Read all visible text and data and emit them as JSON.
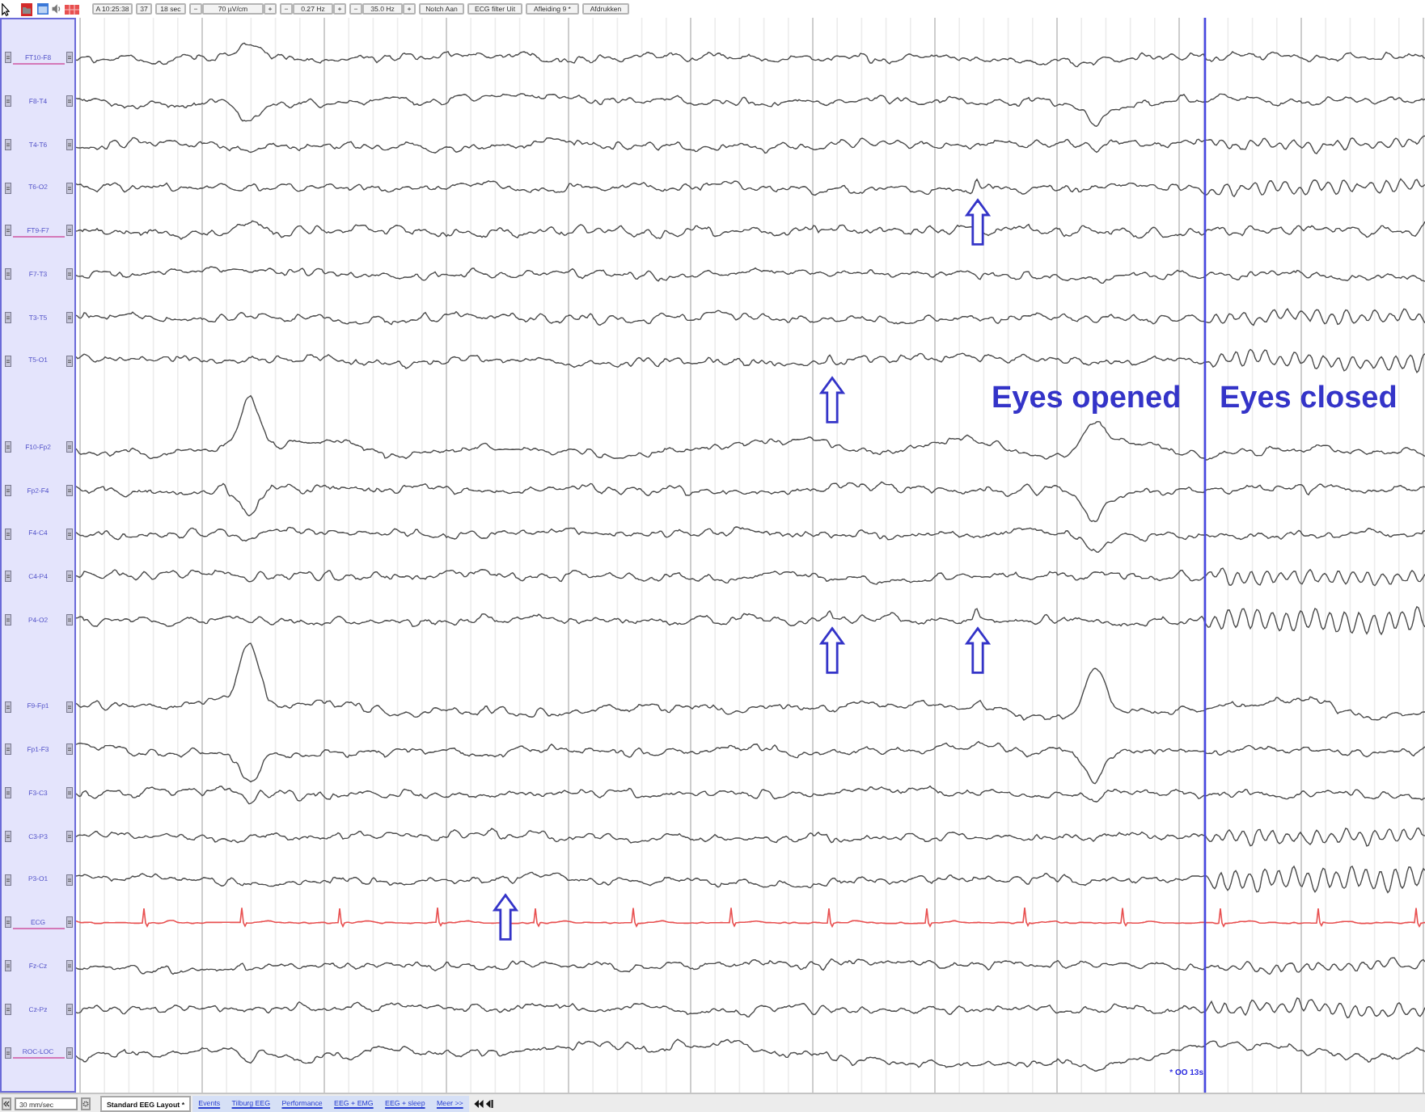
{
  "toolbar": {
    "clock": "A 10:25:38",
    "counter": "37",
    "timebase": "18 sec",
    "steppers": [
      {
        "decrease": "−",
        "value": "70 µV/cm",
        "increase": "+"
      },
      {
        "decrease": "−",
        "value": "0.27 Hz",
        "increase": "+"
      },
      {
        "decrease": "−",
        "value": "35.0 Hz",
        "increase": "+"
      }
    ],
    "buttons": [
      "Notch Aan",
      "ECG filter Uit",
      "Afleiding 9 *",
      "Afdrukken"
    ]
  },
  "channel_groups": [
    {
      "channels": [
        {
          "label": "FT10-F8",
          "kind": "eeg",
          "highlighted": true
        },
        {
          "label": "F8-T4",
          "kind": "eeg",
          "highlighted": false
        },
        {
          "label": "T4-T6",
          "kind": "eeg",
          "highlighted": false
        },
        {
          "label": "T6-O2",
          "kind": "eeg",
          "highlighted": false
        },
        {
          "label": "FT9-F7",
          "kind": "eeg",
          "highlighted": true
        },
        {
          "label": "F7-T3",
          "kind": "eeg",
          "highlighted": false
        },
        {
          "label": "T3-T5",
          "kind": "eeg",
          "highlighted": false
        },
        {
          "label": "T5-O1",
          "kind": "eeg",
          "highlighted": false
        }
      ]
    },
    {
      "channels": [
        {
          "label": "F10-Fp2",
          "kind": "eeg",
          "highlighted": false
        },
        {
          "label": "Fp2-F4",
          "kind": "eeg",
          "highlighted": false
        },
        {
          "label": "F4-C4",
          "kind": "eeg",
          "highlighted": false
        },
        {
          "label": "C4-P4",
          "kind": "eeg",
          "highlighted": false
        },
        {
          "label": "P4-O2",
          "kind": "eeg",
          "highlighted": false
        }
      ]
    },
    {
      "channels": [
        {
          "label": "F9-Fp1",
          "kind": "eeg",
          "highlighted": false
        },
        {
          "label": "Fp1-F3",
          "kind": "eeg",
          "highlighted": false
        },
        {
          "label": "F3-C3",
          "kind": "eeg",
          "highlighted": false
        },
        {
          "label": "C3-P3",
          "kind": "eeg",
          "highlighted": false
        },
        {
          "label": "P3-O1",
          "kind": "eeg",
          "highlighted": false
        },
        {
          "label": "ECG",
          "kind": "ecg",
          "highlighted": true
        },
        {
          "label": "Fz-Cz",
          "kind": "eeg",
          "highlighted": false
        },
        {
          "label": "Cz-Pz",
          "kind": "eeg",
          "highlighted": false
        },
        {
          "label": "ROC-LOC",
          "kind": "eeg",
          "highlighted": true
        }
      ]
    }
  ],
  "annotations": [
    {
      "text": "Eyes opened"
    },
    {
      "text": "Eyes closed"
    }
  ],
  "event_marker": {
    "label": "* OO 13s"
  },
  "bottom_bar": {
    "speed": "30 mm/sec",
    "layout_tabs": [
      {
        "label": "Standard EEG Layout *",
        "selected": true
      },
      {
        "label": "Events",
        "selected": false
      },
      {
        "label": "Tilburg EEG",
        "selected": false
      },
      {
        "label": "Performance",
        "selected": false
      },
      {
        "label": "EEG + EMG",
        "selected": false
      },
      {
        "label": "EEG + sleep",
        "selected": false
      },
      {
        "label": "Meer >>",
        "selected": false
      }
    ]
  }
}
